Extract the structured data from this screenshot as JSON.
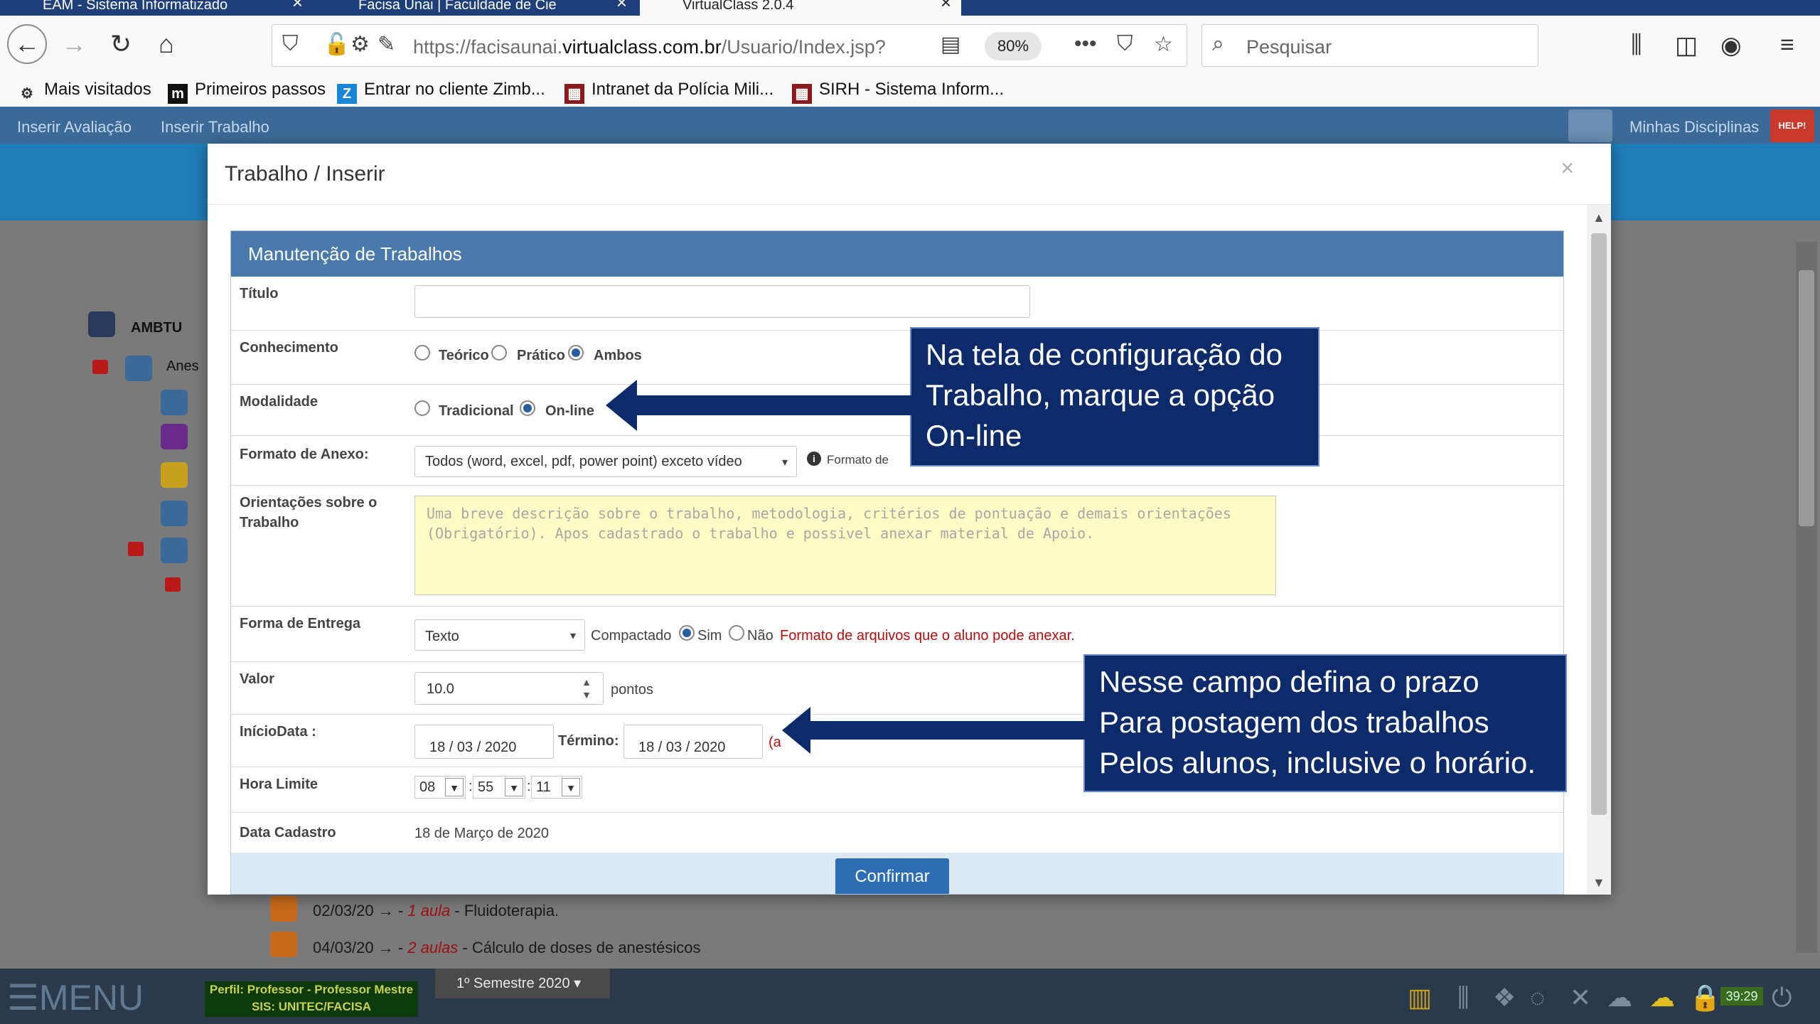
{
  "browser": {
    "tabs": [
      {
        "label": "EAM - Sistema Informatizado"
      },
      {
        "label": "Facisa Unai | Faculdade de Cie"
      },
      {
        "label": "VirtualClass 2.0.4"
      },
      {
        "label": ""
      }
    ],
    "url_prefix": "https://facisaunai.",
    "url_domain": "virtualclass.com.br",
    "url_path": "/Usuario/Index.jsp?",
    "zoom": "80%",
    "search_placeholder": "Pesquisar",
    "bookmarks": [
      {
        "label": "Mais visitados",
        "icon": "gear-icon"
      },
      {
        "label": "Primeiros passos",
        "icon": "m-icon"
      },
      {
        "label": "Entrar no cliente Zimb...",
        "icon": "zimbra-icon"
      },
      {
        "label": "Intranet da Polícia Mili...",
        "icon": "intranet-icon"
      },
      {
        "label": "SIRH - Sistema Inform...",
        "icon": "sirh-icon"
      }
    ]
  },
  "app": {
    "top_menu": [
      "Inserir Avaliação",
      "Inserir Trabalho"
    ],
    "right_link": "Minhas Disciplinas",
    "help_label": "HELP!",
    "tree": {
      "root": "AMBTU",
      "child": "Anes"
    },
    "lessons": [
      {
        "date": "02/03/20",
        "arrow": "→ -",
        "aulas": "1 aula",
        "title": "- Fluidoterapia."
      },
      {
        "date": "04/03/20",
        "arrow": "→ -",
        "aulas": "2 aulas",
        "title": "- Cálculo de doses de anestésicos"
      }
    ],
    "bottom_menu_label": "☰MENU",
    "perfil_line1": "Perfil: Professor - Professor Mestre",
    "perfil_line2": "SIS: UNITEC/FACISA",
    "semestre": "1º Semestre 2020",
    "clock": "39:29"
  },
  "modal": {
    "title": "Trabalho / Inserir",
    "close": "×",
    "panel_title": "Manutenção de Trabalhos",
    "fields": {
      "titulo_label": "Título",
      "titulo_value": "",
      "conhecimento_label": "Conhecimento",
      "conhecimento_options": [
        "Teórico",
        "Prático",
        "Ambos"
      ],
      "conhecimento_selected": "Ambos",
      "modalidade_label": "Modalidade",
      "modalidade_options": [
        "Tradicional",
        "On-line"
      ],
      "modalidade_selected": "On-line",
      "formato_label": "Formato de Anexo:",
      "formato_value": "Todos (word, excel, pdf, power point) exceto vídeo",
      "formato_hint": "Formato de",
      "orientacoes_label": "Orientações sobre o Trabalho",
      "orientacoes_placeholder": "Uma breve descrição sobre o trabalho, metodologia, critérios de pontuação e demais orientações (Obrigatório). Apos cadastrado o trabalho e possivel anexar material de Apoio.",
      "entrega_label": "Forma de Entrega",
      "entrega_value": "Texto",
      "compactado_label": "Compactado",
      "compactado_options": [
        "Sim",
        "Não"
      ],
      "compactado_selected": "Sim",
      "entrega_hint": "Formato de arquivos que o aluno pode anexar.",
      "valor_label": "Valor",
      "valor_value": "10.0",
      "valor_unit": "pontos",
      "inicio_label": "InícioData :",
      "inicio_value": "18 / 03 / 2020",
      "termino_label": "Término:",
      "termino_value": "18 / 03 / 2020",
      "termino_hint": "(a",
      "hora_label": "Hora Limite",
      "hora_h": "08",
      "hora_m": "55",
      "hora_s": "11",
      "hora_sep": ":",
      "cadastro_label": "Data Cadastro",
      "cadastro_value": "18 de Março de 2020"
    },
    "confirm_label": "Confirmar"
  },
  "callouts": {
    "modalidade_lines": [
      "Na tela de configuração do",
      "Trabalho, marque a opção",
      "On-line"
    ],
    "prazo_lines": [
      "Nesse campo defina o prazo",
      "Para postagem dos trabalhos",
      "Pelos alunos, inclusive o horário."
    ]
  },
  "colors": {
    "callout_bg": "#0d2b6b",
    "panel_header": "#4a79ac",
    "confirm_button": "#2d6db3",
    "textarea_bg": "#fffbc4",
    "hint_red": "#b50f0f"
  }
}
